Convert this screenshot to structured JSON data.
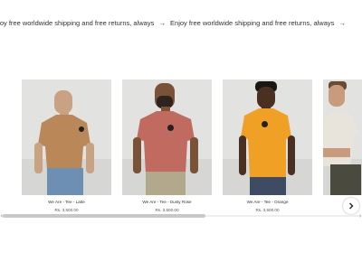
{
  "announcement": {
    "text_1": "njoy free worldwide shipping and free returns, always",
    "text_2": "Enjoy free worldwide shipping and free returns, always",
    "arrow": "→"
  },
  "products": [
    {
      "name": "We Are - Tee - Latte",
      "price": "Rs. 3,500.00",
      "shirt_color": "#b98758"
    },
    {
      "name": "We Are - Tee - Dusty Rose",
      "price": "Rs. 3,500.00",
      "shirt_color": "#c06a60"
    },
    {
      "name": "We Are - Tee - Orange",
      "price": "Rs. 3,500.00",
      "shirt_color": "#f0a024"
    },
    {
      "name": "",
      "price": "",
      "shirt_color": "#e8e4dc"
    }
  ],
  "icons": {
    "next": "chevron-right-icon"
  },
  "colors": {
    "background": "#ffffff",
    "photo_backdrop": "#e2e2e0"
  }
}
